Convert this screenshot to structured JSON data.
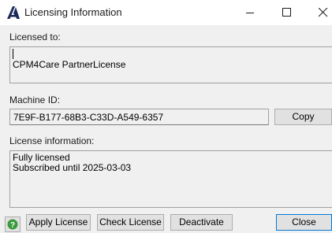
{
  "window": {
    "title": "Licensing Information",
    "icon": "app-logo-icon"
  },
  "licensed_to": {
    "label": "Licensed to:",
    "value": "CPM4Care PartnerLicense"
  },
  "machine_id": {
    "label": "Machine ID:",
    "value": "7E9F-B177-68B3-C33D-A549-6357",
    "copy_label": "Copy"
  },
  "license_info": {
    "label": "License information:",
    "lines": [
      "Fully licensed",
      "Subscribed until 2025-03-03"
    ]
  },
  "footer": {
    "help_icon": "help-icon",
    "apply_label": "Apply License",
    "check_label": "Check License",
    "deactivate_label": "Deactivate",
    "close_label": "Close"
  },
  "colors": {
    "accent": "#0078d7",
    "help_green": "#3a9a3a",
    "logo_navy": "#1c2a5c"
  }
}
